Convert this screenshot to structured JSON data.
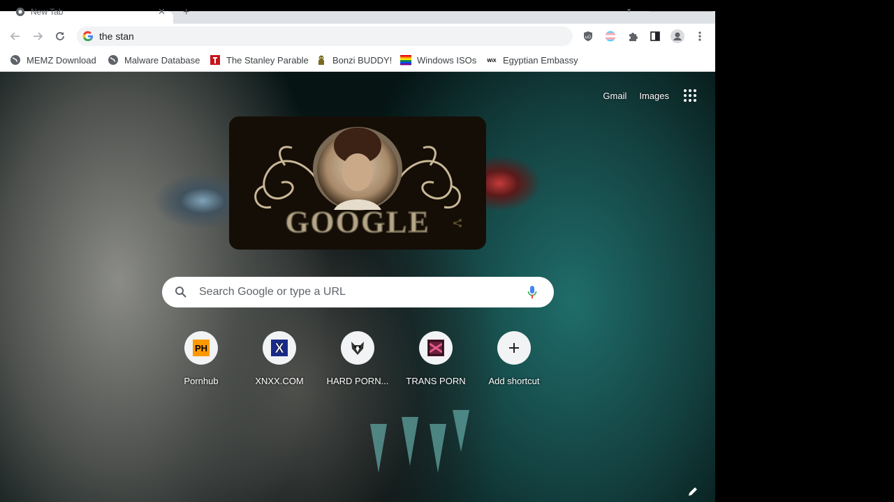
{
  "tab": {
    "title": "New Tab",
    "favicon": "chrome-icon"
  },
  "toolbar": {
    "omnibox_value": "the stan",
    "extensions": [
      "ublock-icon",
      "trans-flag-icon",
      "puzzle-icon",
      "side-panel-icon",
      "profile-icon",
      "kebab-menu-icon"
    ]
  },
  "bookmarks": [
    {
      "label": "MEMZ Download",
      "icon": "globe-icon"
    },
    {
      "label": "Malware Database",
      "icon": "globe-icon"
    },
    {
      "label": "The Stanley Parable",
      "icon": "stanley-icon"
    },
    {
      "label": "Bonzi BUDDY!",
      "icon": "bonzi-icon"
    },
    {
      "label": "Windows ISOs",
      "icon": "windows-icon"
    },
    {
      "label": "Egyptian Embassy",
      "icon": "wix-icon"
    }
  ],
  "ntp": {
    "gmail": "Gmail",
    "images": "Images",
    "doodle_text": "GOOGLE",
    "search_placeholder": "Search Google or type a URL",
    "shortcuts": [
      {
        "label": "Pornhub",
        "icon": "ph-icon",
        "icon_text": "PH"
      },
      {
        "label": "XNXX.COM",
        "icon": "x-icon",
        "icon_text": "X"
      },
      {
        "label": "HARD PORN...",
        "icon": "wolf-icon"
      },
      {
        "label": "TRANS PORN",
        "icon": "trans-porn-icon"
      },
      {
        "label": "Add shortcut",
        "icon": "plus-icon"
      }
    ]
  },
  "colors": {
    "accent_blue": "#1a73e8",
    "toolbar_bg": "#ffffff",
    "omnibox_bg": "#f1f3f4"
  }
}
